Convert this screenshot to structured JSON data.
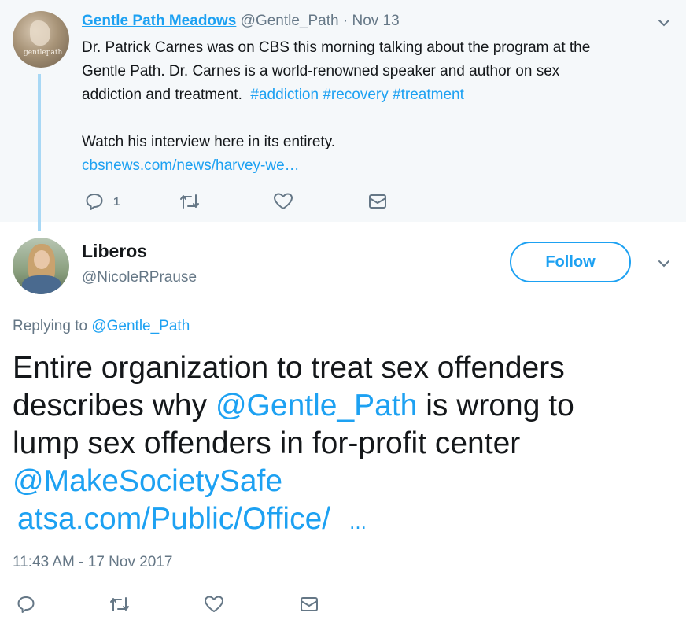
{
  "parent_tweet": {
    "display_name": "Gentle Path Meadows",
    "handle": "@Gentle_Path",
    "separator": " · ",
    "date": "Nov 13",
    "avatar_label": "gentlepath",
    "text_line1": "Dr. Patrick Carnes was on CBS this morning talking about the program at the",
    "text_line2": "Gentle Path.  Dr. Carnes is a world-renowned speaker and author on sex",
    "text_line3": "addiction and treatment.",
    "hashtags": [
      "#addiction",
      "#recovery",
      "#treatment"
    ],
    "text_line4": "Watch his interview here in its entirety.",
    "link": "cbsnews.com/news/harvey-we…",
    "reply_count": "1"
  },
  "reply_tweet": {
    "display_name": "Liberos",
    "handle": "@NicoleRPrause",
    "follow_label": "Follow",
    "replying_to_label": "Replying to",
    "replying_to_handle": "@Gentle_Path",
    "text_line1": "Entire organization to treat sex offenders",
    "text_line2_a": "describes why",
    "text_line2_mention": "@Gentle_Path",
    "text_line2_b": "is wrong to",
    "text_line3": "lump sex offenders in for-profit center",
    "text_line4_mention": "@MakeSocietySafe",
    "link": "atsa.com/Public/Office/",
    "ellipsis": "...",
    "timestamp": "11:43 AM - 17 Nov 2017"
  },
  "icons": {
    "reply": "reply-icon",
    "retweet": "retweet-icon",
    "like": "heart-icon",
    "message": "envelope-icon",
    "menu": "chevron-down-icon"
  },
  "colors": {
    "accent": "#1da1f2",
    "muted": "#657786",
    "parent_bg": "#f5f8fa",
    "thread_line": "#a8d8f5"
  }
}
